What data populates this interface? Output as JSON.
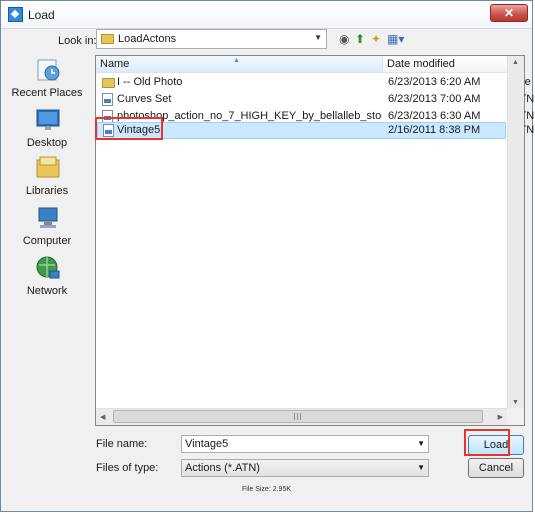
{
  "window": {
    "title": "Load",
    "close_glyph": "✕"
  },
  "lookin": {
    "label": "Look in:",
    "value": "LoadActons"
  },
  "toolbar": {
    "back_icon": "back-icon",
    "up_icon": "up-folder-icon",
    "newfolder_icon": "new-folder-icon",
    "views_icon": "views-menu-icon"
  },
  "sidebar": {
    "items": [
      {
        "label": "Recent Places",
        "icon": "recent-places-icon"
      },
      {
        "label": "Desktop",
        "icon": "desktop-icon"
      },
      {
        "label": "Libraries",
        "icon": "libraries-icon"
      },
      {
        "label": "Computer",
        "icon": "computer-icon"
      },
      {
        "label": "Network",
        "icon": "network-icon"
      }
    ]
  },
  "filelist": {
    "headers": {
      "name": "Name",
      "date": "Date modified",
      "type": "Typ"
    },
    "rows": [
      {
        "name": "I -- Old Photo",
        "date": "6/23/2013 6:20 AM",
        "type": "File",
        "kind": "folder"
      },
      {
        "name": "Curves Set",
        "date": "6/23/2013 7:00 AM",
        "type": "ATN",
        "kind": "atn"
      },
      {
        "name": "photoshop_action_no_7_HIGH_KEY_by_bellalleb_stock",
        "date": "6/23/2013 6:30 AM",
        "type": "ATN",
        "kind": "atn"
      },
      {
        "name": "Vintage5",
        "date": "2/16/2011 8:38 PM",
        "type": "ATN",
        "kind": "atn",
        "selected": true
      }
    ]
  },
  "form": {
    "filename_label": "File name:",
    "filename_value": "Vintage5",
    "filetype_label": "Files of type:",
    "filetype_value": "Actions (*.ATN)",
    "load_label": "Load",
    "cancel_label": "Cancel",
    "filesize": "File Size: 2.95K"
  },
  "colors": {
    "highlight": "#e8352a",
    "selection": "#cce8ff"
  }
}
